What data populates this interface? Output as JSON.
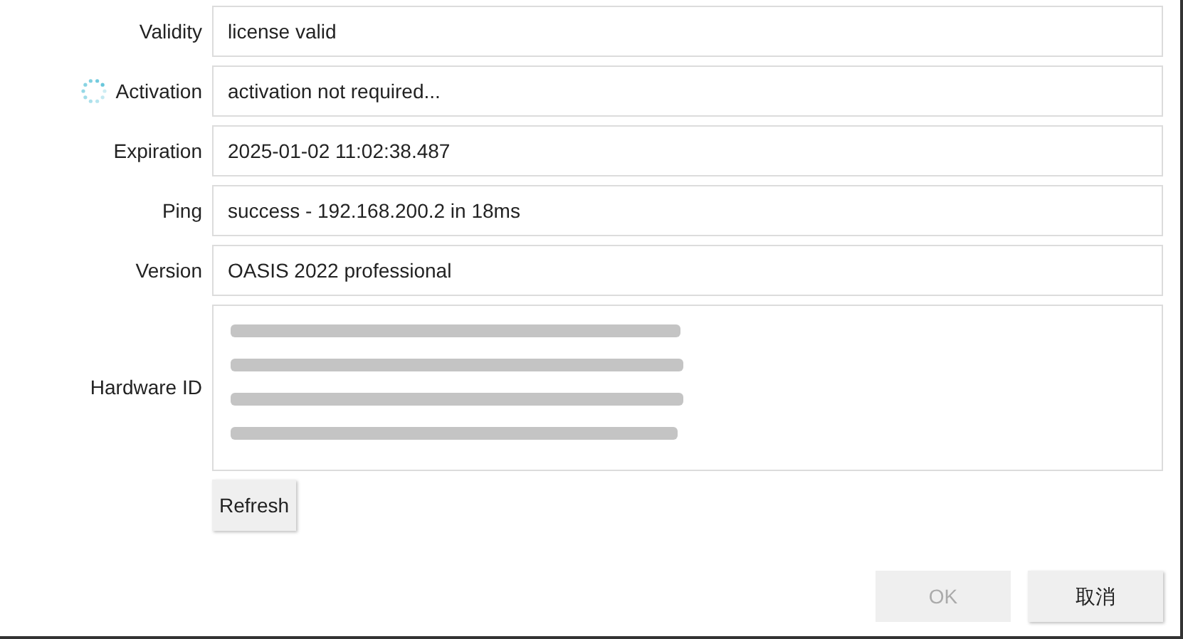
{
  "fields": [
    {
      "label": "Validity",
      "value": "license valid",
      "busy": false
    },
    {
      "label": "Activation",
      "value": "activation not required...",
      "busy": true
    },
    {
      "label": "Expiration",
      "value": "2025-01-02 11:02:38.487",
      "busy": false
    },
    {
      "label": "Ping",
      "value": "success - 192.168.200.2 in 18ms",
      "busy": false
    },
    {
      "label": "Version",
      "value": "OASIS 2022 professional",
      "busy": false
    }
  ],
  "hardware_id": {
    "label": "Hardware ID"
  },
  "refresh_button": {
    "label": "Refresh"
  },
  "buttons": [
    {
      "label": "OK",
      "disabled": true
    },
    {
      "label": "取消",
      "disabled": false
    }
  ]
}
